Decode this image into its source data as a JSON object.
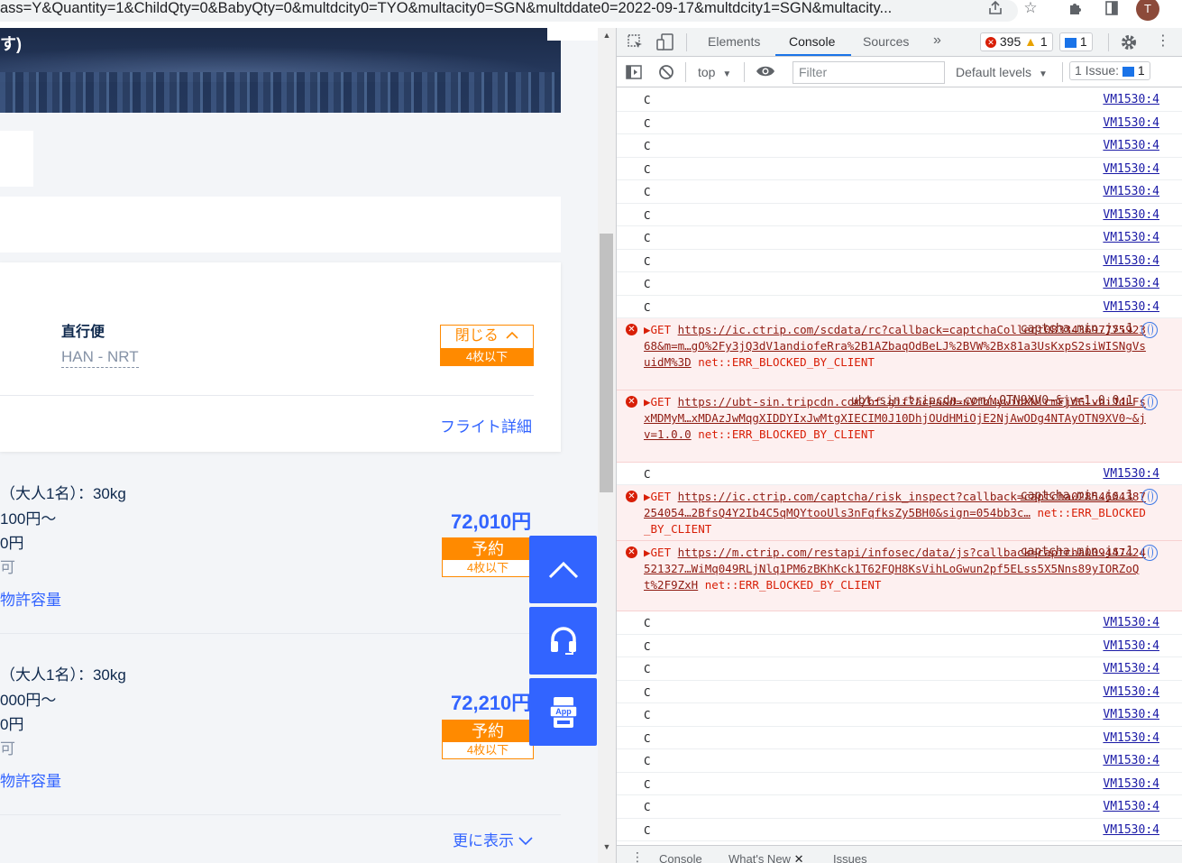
{
  "browser": {
    "url": "ass=Y&Quantity=1&ChildQty=0&BabyQty=0&multdcity0=TYO&multacity0=SGN&multddate0=2022-09-17&multdcity1=SGN&multacity...",
    "avatar_letter": "T",
    "icons": [
      "share-icon",
      "star-icon",
      "extensions-icon",
      "sidebar-icon"
    ]
  },
  "page": {
    "hero_title": "す)",
    "flight": {
      "type_label": "直行便",
      "route": "HAN - NRT",
      "close_label": "閉じる",
      "close_seats": "4枚以下",
      "detail_link": "フライト詳細"
    },
    "fares": [
      {
        "baggage": "（大人1名）：30kg",
        "change_fee": "100円～",
        "cancel_fee": "0円",
        "note": "可",
        "allowance_link": "物許容量",
        "price": "72,010円",
        "book_label": "予約",
        "seats": "4枚以下"
      },
      {
        "baggage": "（大人1名）：30kg",
        "change_fee": "000円～",
        "cancel_fee": "0円",
        "note": "可",
        "allowance_link": "物許容量",
        "price": "72,210円",
        "book_label": "予約",
        "seats": "4枚以下"
      }
    ],
    "more_link": "更に表示",
    "float_app_label": "App"
  },
  "devtools": {
    "tabs": [
      "Elements",
      "Console",
      "Sources"
    ],
    "active_tab": "Console",
    "error_count": "395",
    "warning_count": "1",
    "info_count": "1",
    "context": "top",
    "filter_placeholder": "Filter",
    "levels": "Default levels",
    "issues": "1 Issue:",
    "issues_count": "1",
    "log_source": "VM1530:4",
    "log_msg": "C",
    "errors": [
      {
        "method": "GET",
        "url": "https://ic.ctrip.com/scdata/rc?callback=captchaCollect08334369777592368&m=m…gO%2Fy3jQ3dV1andiofeRra%2B1AZbaqOdBeLJ%2BVW%2Bx81a3UsKxpS2siWISNgVsuidM%3D",
        "status": "net::ERR_BLOCKED_BY_CLIENT",
        "source": "captcha.min.js:1"
      },
      {
        "method": "GET",
        "url": "https://ubt-sin.tripcdn.com/bf.gif?ac=a&d=uVtbMywidXNlcmFjdGlvbiJdLFsxMDMyM…xMDAzJwMqgXIDDYIxJwMtgXIECIM0J10DhjOUdHMiOjE2NjAwODg4NTAyOTN9XV0~&jv=1.0.0",
        "status": "net::ERR_BLOCKED_BY_CLIENT",
        "source": "ubt-sin.tripcdn.com/…OTN9XV0~&jv=1.0.0:1"
      },
      {
        "method": "GET",
        "url": "https://ic.ctrip.com/captcha/risk_inspect?callback=captcha02854604387254054…2BfsQ4Y2Ib4C5qMQYtooUls3nFqfksZy5BH0&sign=054bb3c…",
        "status": "net::ERR_BLOCKED_BY_CLIENT",
        "source": "captcha.min.js:1"
      },
      {
        "method": "GET",
        "url": "https://m.ctrip.com/restapi/infosec/data/js?callback=captcha009447424521327…WiMq049RLjNlq1PM6zBKhKck1T62FQH8KsVihLoGwun2pf5ELss5X5Nns89yIORZoQt%2F9ZxH",
        "status": "net::ERR_BLOCKED_BY_CLIENT",
        "source": "captcha.min.js:1"
      }
    ],
    "drawer_tabs": [
      "Console",
      "What's New",
      "Issues"
    ]
  }
}
